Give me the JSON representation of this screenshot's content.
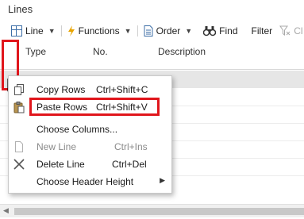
{
  "panel": {
    "title": "Lines"
  },
  "toolbar": {
    "line_label": "Line",
    "functions_label": "Functions",
    "order_label": "Order",
    "find_label": "Find",
    "filter_label": "Filter",
    "clear_label": "Cl"
  },
  "columns": [
    "Type",
    "No.",
    "Description"
  ],
  "context_menu": {
    "copy_rows": {
      "label": "Copy Rows",
      "shortcut": "Ctrl+Shift+C"
    },
    "paste_rows": {
      "label": "Paste Rows",
      "shortcut": "Ctrl+Shift+V"
    },
    "choose_columns": {
      "label": "Choose Columns..."
    },
    "new_line": {
      "label": "New Line",
      "shortcut": "Ctrl+Ins"
    },
    "delete_line": {
      "label": "Delete Line",
      "shortcut": "Ctrl+Del"
    },
    "choose_header_height": {
      "label": "Choose Header Height"
    }
  },
  "colors": {
    "highlight_box": "#e0161c",
    "toolbar_icon": "#3c6ea6",
    "functions_icon": "#e8a400",
    "selected_row": "#e6e6e6"
  }
}
